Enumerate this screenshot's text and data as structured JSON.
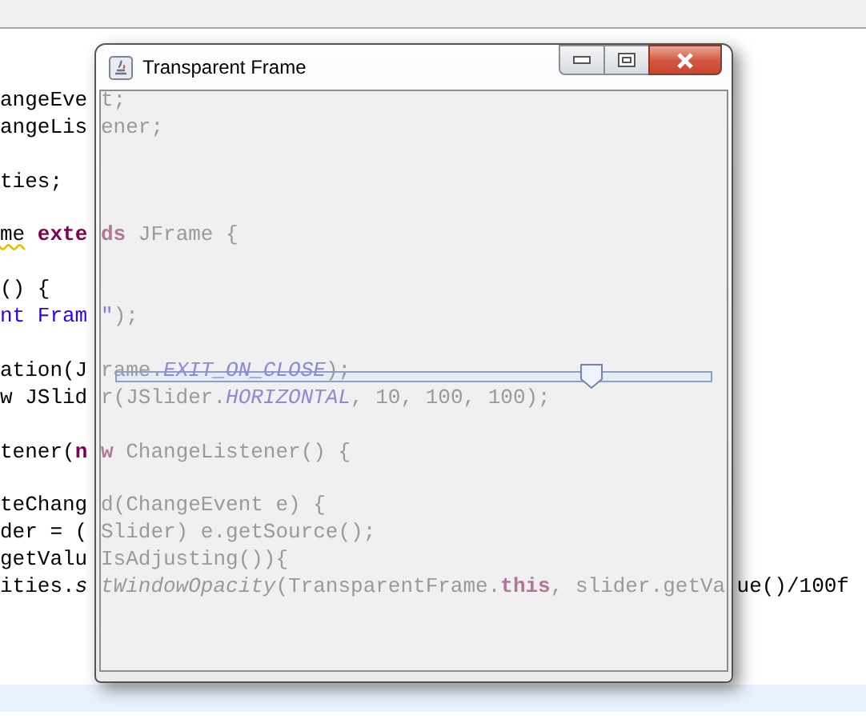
{
  "editor": {
    "code_blocks": [
      [
        {
          "outside": [
            {
              "kind": "plain",
              "text": "angeEve"
            }
          ],
          "through_window": [
            {
              "kind": "plain",
              "text": "t;"
            }
          ]
        },
        {
          "outside": [
            {
              "kind": "plain",
              "text": "angeLis"
            }
          ],
          "through_window": [
            {
              "kind": "plain",
              "text": "ener;"
            }
          ]
        }
      ],
      [
        {
          "outside": [
            {
              "kind": "plain",
              "text": "ties;"
            }
          ]
        }
      ],
      [
        {
          "outside": [
            {
              "kind": "warning",
              "text": "me"
            },
            {
              "kind": "keyword",
              "text": " exte"
            }
          ],
          "through_window": [
            {
              "kind": "keyword",
              "text": "ds"
            },
            {
              "kind": "plain",
              "text": " JFrame {"
            }
          ]
        }
      ],
      [
        {
          "outside": [
            {
              "kind": "plain",
              "text": "() {"
            }
          ]
        },
        {
          "outside": [
            {
              "kind": "string",
              "text": "nt Fram"
            }
          ],
          "through_window": [
            {
              "kind": "string",
              "text": "\""
            },
            {
              "kind": "plain",
              "text": ");"
            }
          ]
        }
      ],
      [
        {
          "outside": [
            {
              "kind": "plain",
              "text": "ation(J"
            }
          ],
          "through_window": [
            {
              "kind": "plain",
              "text": "rame."
            },
            {
              "kind": "field",
              "text": "EXIT_ON_CLOSE"
            },
            {
              "kind": "plain",
              "text": ");"
            }
          ]
        },
        {
          "outside": [
            {
              "kind": "plain",
              "text": "w JSlid"
            }
          ],
          "through_window": [
            {
              "kind": "plain",
              "text": "r(JSlider."
            },
            {
              "kind": "field",
              "text": "HORIZONTAL"
            },
            {
              "kind": "plain",
              "text": ", 10, 100, 100);"
            }
          ]
        }
      ],
      [
        {
          "outside": [
            {
              "kind": "plain",
              "text": "tener("
            },
            {
              "kind": "keyword",
              "text": "n"
            }
          ],
          "through_window": [
            {
              "kind": "keyword",
              "text": "w"
            },
            {
              "kind": "plain",
              "text": " ChangeListener() {"
            }
          ]
        }
      ],
      [
        {
          "outside": [
            {
              "kind": "plain",
              "text": "teChang"
            }
          ],
          "through_window": [
            {
              "kind": "plain",
              "text": "d(ChangeEvent e) {"
            }
          ]
        },
        {
          "outside": [
            {
              "kind": "plain",
              "text": "der = ("
            }
          ],
          "through_window": [
            {
              "kind": "plain",
              "text": "Slider) e.getSource();"
            }
          ]
        },
        {
          "outside": [
            {
              "kind": "plain",
              "text": "getValu"
            }
          ],
          "through_window": [
            {
              "kind": "plain",
              "text": "IsAdjusting()){"
            }
          ]
        },
        {
          "outside": [
            {
              "kind": "plain",
              "text": "ities."
            },
            {
              "kind": "static",
              "text": "s"
            }
          ],
          "through_window": [
            {
              "kind": "static",
              "text": "tWindowOpacity"
            },
            {
              "kind": "plain",
              "text": "(TransparentFrame."
            },
            {
              "kind": "keyword",
              "text": "this"
            },
            {
              "kind": "plain",
              "text": ", slider.getVa"
            }
          ],
          "outside_right": [
            {
              "kind": "plain",
              "text": "ue()/100f"
            }
          ]
        }
      ]
    ]
  },
  "window": {
    "title": "Transparent Frame"
  },
  "slider": {
    "level": 0.81
  }
}
